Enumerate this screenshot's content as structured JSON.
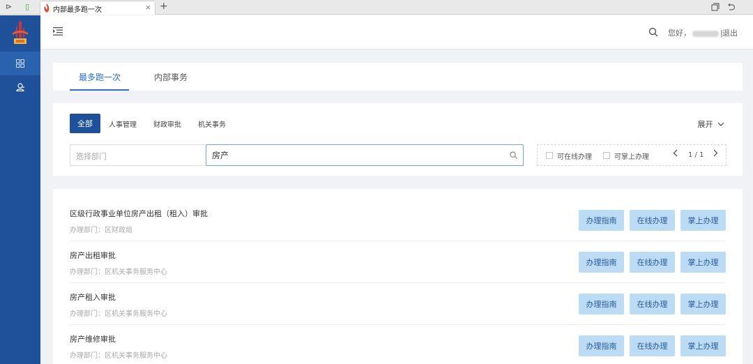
{
  "browser": {
    "tab_title": "内部最多跑一次",
    "tab_close": "×",
    "new_tab": "+",
    "left_controls": [
      "⊳",
      "▯"
    ]
  },
  "header": {
    "greeting": "您好，",
    "separator": "|",
    "logout": "退出"
  },
  "sidebar": {
    "items": [
      {
        "icon": "grid-icon",
        "active": true
      },
      {
        "icon": "user-icon",
        "active": false
      }
    ]
  },
  "main_tabs": [
    {
      "label": "最多跑一次",
      "active": true
    },
    {
      "label": "内部事务",
      "active": false
    }
  ],
  "filters": {
    "categories": [
      "全部",
      "人事管理",
      "财政审批",
      "机关事务"
    ],
    "expand_label": "展开",
    "department_placeholder": "选择部门",
    "search_value": "房产",
    "online_label": "可在线办理",
    "mobile_label": "可掌上办理",
    "pager": "1 / 1"
  },
  "items": [
    {
      "title": "区级行政事业单位房产出租（租入）审批",
      "dept": "办理部门：区财政局"
    },
    {
      "title": "房产出租审批",
      "dept": "办理部门：区机关事务服务中心"
    },
    {
      "title": "房产租入审批",
      "dept": "办理部门：区机关事务服务中心"
    },
    {
      "title": "房产维修审批",
      "dept": "办理部门：区机关事务服务中心"
    }
  ],
  "actions": {
    "guide": "办理指南",
    "online": "在线办理",
    "mobile": "掌上办理"
  },
  "colors": {
    "sidebar": "#1e5199",
    "accent": "#2a6fc9",
    "action_button": "#bcdcf6"
  }
}
